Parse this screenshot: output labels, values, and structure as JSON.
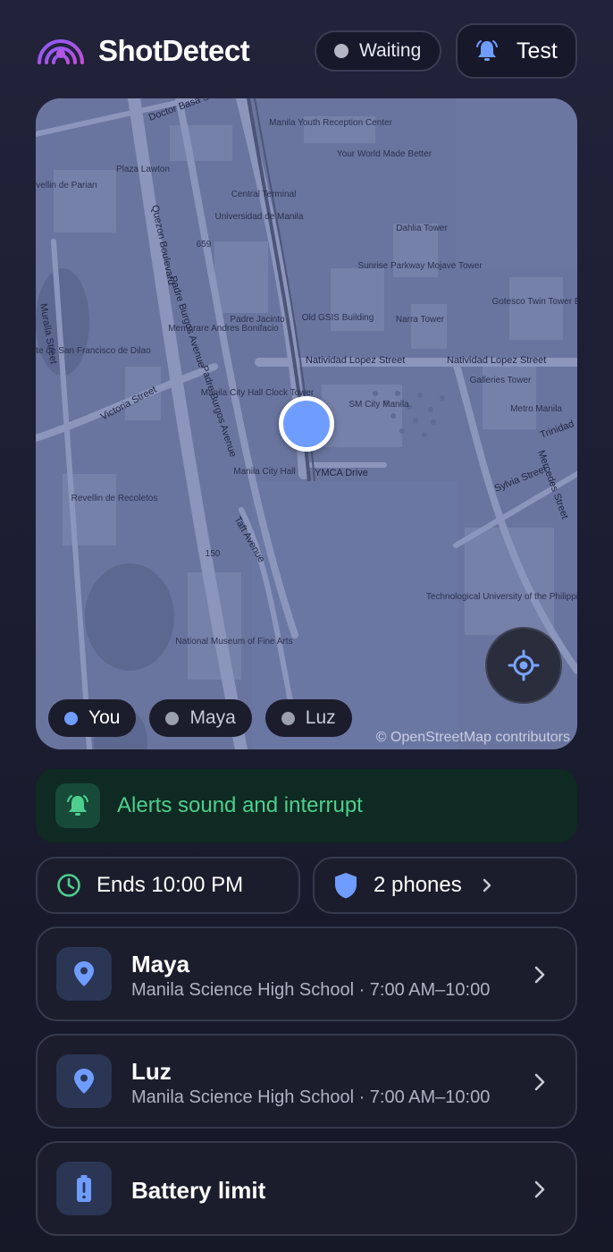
{
  "header": {
    "app_title": "ShotDetect",
    "status_label": "Waiting",
    "test_label": "Test"
  },
  "map": {
    "attribution": "© OpenStreetMap contributors",
    "street_labels": [
      "Natividad Lopez Street",
      "Natividad Lopez Street",
      "Padre Burgos Avenue",
      "Padre Burgos Avenue",
      "Quezon Boulevard",
      "Victoria Street",
      "YMCA Drive",
      "Sylvia Street",
      "Mercedes Street",
      "Doctor Basa Street",
      "Muralla Street",
      "Taft Avenue",
      "Trinidad"
    ],
    "place_labels": [
      "Central Terminal",
      "Universidad de Manila",
      "Manila Youth Reception Center",
      "Your World Made Better",
      "Plaza Lawton",
      "Dahlia Tower",
      "Sunrise Parkway Mojave Tower",
      "Narra Tower",
      "Gotesco Twin Tower B",
      "Old GSIS Building",
      "Memorare Andres Bonifacio",
      "Padre Jacinto",
      "Manila City Hall Clock Tower",
      "SM City Manila",
      "Manila City Hall",
      "Galleries Tower",
      "Metro Manila",
      "Revellin de Recoletos",
      "Baluarte de San Francisco de Dilao",
      "Revellin de Parian",
      "National Museum of Fine Arts",
      "Technological University of the Philippines",
      "659",
      "150"
    ],
    "chips": [
      {
        "label": "You",
        "color": "#6f9cff"
      },
      {
        "label": "Maya",
        "color": "#9aa0ad"
      },
      {
        "label": "Luz",
        "color": "#9aa0ad"
      }
    ]
  },
  "alert_banner": {
    "label": "Alerts sound and interrupt"
  },
  "schedule": {
    "ends_label": "Ends 10:00 PM",
    "phones_label": "2 phones"
  },
  "members": [
    {
      "name": "Maya",
      "detail": "Manila Science High School · 7:00 AM–10:00"
    },
    {
      "name": "Luz",
      "detail": "Manila Science High School · 7:00 AM–10:00"
    }
  ],
  "battery": {
    "label": "Battery limit"
  },
  "colors": {
    "accent_blue": "#6f9cff",
    "alert_green": "#4ecf8e",
    "map_base": "#6a759f"
  }
}
